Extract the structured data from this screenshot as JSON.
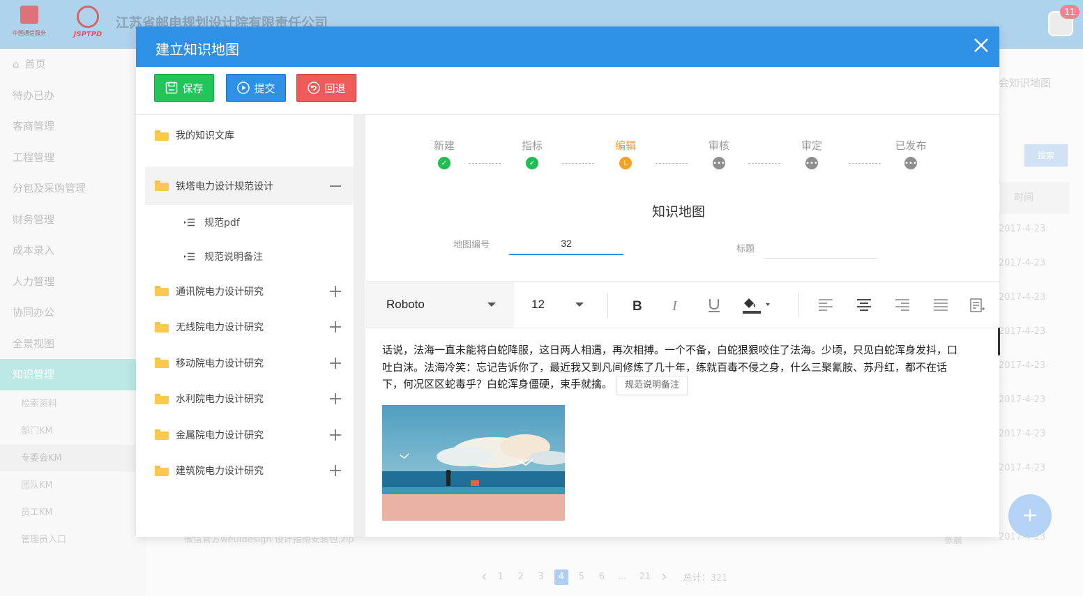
{
  "app": {
    "company_name": "江苏省邮电规划设计院有限责任公司",
    "logo1_caption": "中国通信服务",
    "logo2_caption": "JSPTPD",
    "notification_count": "11"
  },
  "sidebar": {
    "items": [
      {
        "label": "首页",
        "icon": "home-icon"
      },
      {
        "label": "待办已办"
      },
      {
        "label": "客商管理"
      },
      {
        "label": "工程管理"
      },
      {
        "label": "分包及采购管理"
      },
      {
        "label": "财务管理"
      },
      {
        "label": "成本录入"
      },
      {
        "label": "人力管理"
      },
      {
        "label": "协同办公"
      },
      {
        "label": "全景视图"
      },
      {
        "label": "知识管理",
        "active": true
      }
    ],
    "subitems": [
      "检索资料",
      "部门KM",
      "专委会KM",
      "团队KM",
      "员工KM",
      "管理员入口"
    ],
    "selected_sub": "专委会KM"
  },
  "background": {
    "crumb": "会知识地图",
    "search_label": "搜索",
    "col_time": "时间",
    "dates": [
      "2017-4-23",
      "2017-4-23",
      "2017-4-23",
      "2017-4-23",
      "2017-4-23",
      "2017-4-23",
      "2017-4-23",
      "2017-4-23",
      "2017-4-23"
    ],
    "file_name": "微信官方weuidesign 设计指南安装包.zip",
    "author": "张晨",
    "pager": {
      "pages": [
        "1",
        "2",
        "3",
        "4",
        "5",
        "6",
        "...",
        "21"
      ],
      "current": "4",
      "total_label": "总计：321"
    }
  },
  "modal": {
    "title": "建立知识地图",
    "buttons": {
      "save": "保存",
      "submit": "提交",
      "back": "回退"
    },
    "tree": {
      "library": "我的知识文库",
      "open_folder": "铁塔电力设计规范设计",
      "children": [
        "规范pdf",
        "规范说明备注"
      ],
      "folders": [
        "通讯院电力设计研究",
        "无线院电力设计研究",
        "移动院电力设计研究",
        "水利院电力设计研究",
        "金属院电力设计研究",
        "建筑院电力设计研究"
      ]
    },
    "steps": [
      {
        "label": "新建",
        "state": "done"
      },
      {
        "label": "指标",
        "state": "done"
      },
      {
        "label": "编辑",
        "state": "current"
      },
      {
        "label": "审核",
        "state": "todo"
      },
      {
        "label": "审定",
        "state": "todo"
      },
      {
        "label": "已发布",
        "state": "todo"
      }
    ],
    "form": {
      "heading": "知识地图",
      "map_no_label": "地图编号",
      "map_no_value": "32",
      "title_label": "标题",
      "title_value": ""
    },
    "editor": {
      "font": "Roboto",
      "size": "12",
      "text": "话说，法海一直未能将白蛇降服，这日两人相遇，再次相搏。一个不备，白蛇狠狠咬住了法海。少顷，只见白蛇浑身发抖，口吐白沫。法海冷笑：忘记告诉你了，最近我又到凡间修炼了几十年，练就百毒不侵之身，什么三聚氰胺、苏丹红，都不在话下，何况区区蛇毒乎？白蛇浑身僵硬，束手就擒。",
      "tooltip": "规范说明备注"
    }
  },
  "colors": {
    "primary": "#2f91e6",
    "success": "#21c55a",
    "danger": "#f05a5a",
    "warning": "#f3a12b"
  }
}
